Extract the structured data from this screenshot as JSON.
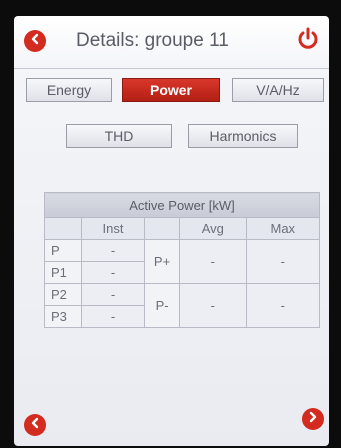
{
  "header": {
    "title": "Details: groupe 11",
    "back_icon": "chevron-left-icon",
    "power_icon": "power-icon",
    "accent": "#d32b1f"
  },
  "tabs_row1": [
    {
      "label": "Energy",
      "active": false
    },
    {
      "label": "Power",
      "active": true
    },
    {
      "label": "V/A/Hz",
      "active": false
    }
  ],
  "tabs_row2": [
    {
      "label": "THD",
      "active": false
    },
    {
      "label": "Harmonics",
      "active": false
    }
  ],
  "table": {
    "caption": "Active Power [kW]",
    "col_inst": "Inst",
    "col_avg": "Avg",
    "col_max": "Max",
    "rows": [
      {
        "label": "P",
        "inst": "-"
      },
      {
        "label": "P1",
        "inst": "-"
      },
      {
        "label": "P2",
        "inst": "-"
      },
      {
        "label": "P3",
        "inst": "-"
      }
    ],
    "groups": [
      {
        "label": "P+",
        "avg": "-",
        "max": "-"
      },
      {
        "label": "P-",
        "avg": "-",
        "max": "-"
      }
    ]
  },
  "footer": {
    "prev_icon": "chevron-left-icon",
    "next_icon": "chevron-right-icon"
  }
}
